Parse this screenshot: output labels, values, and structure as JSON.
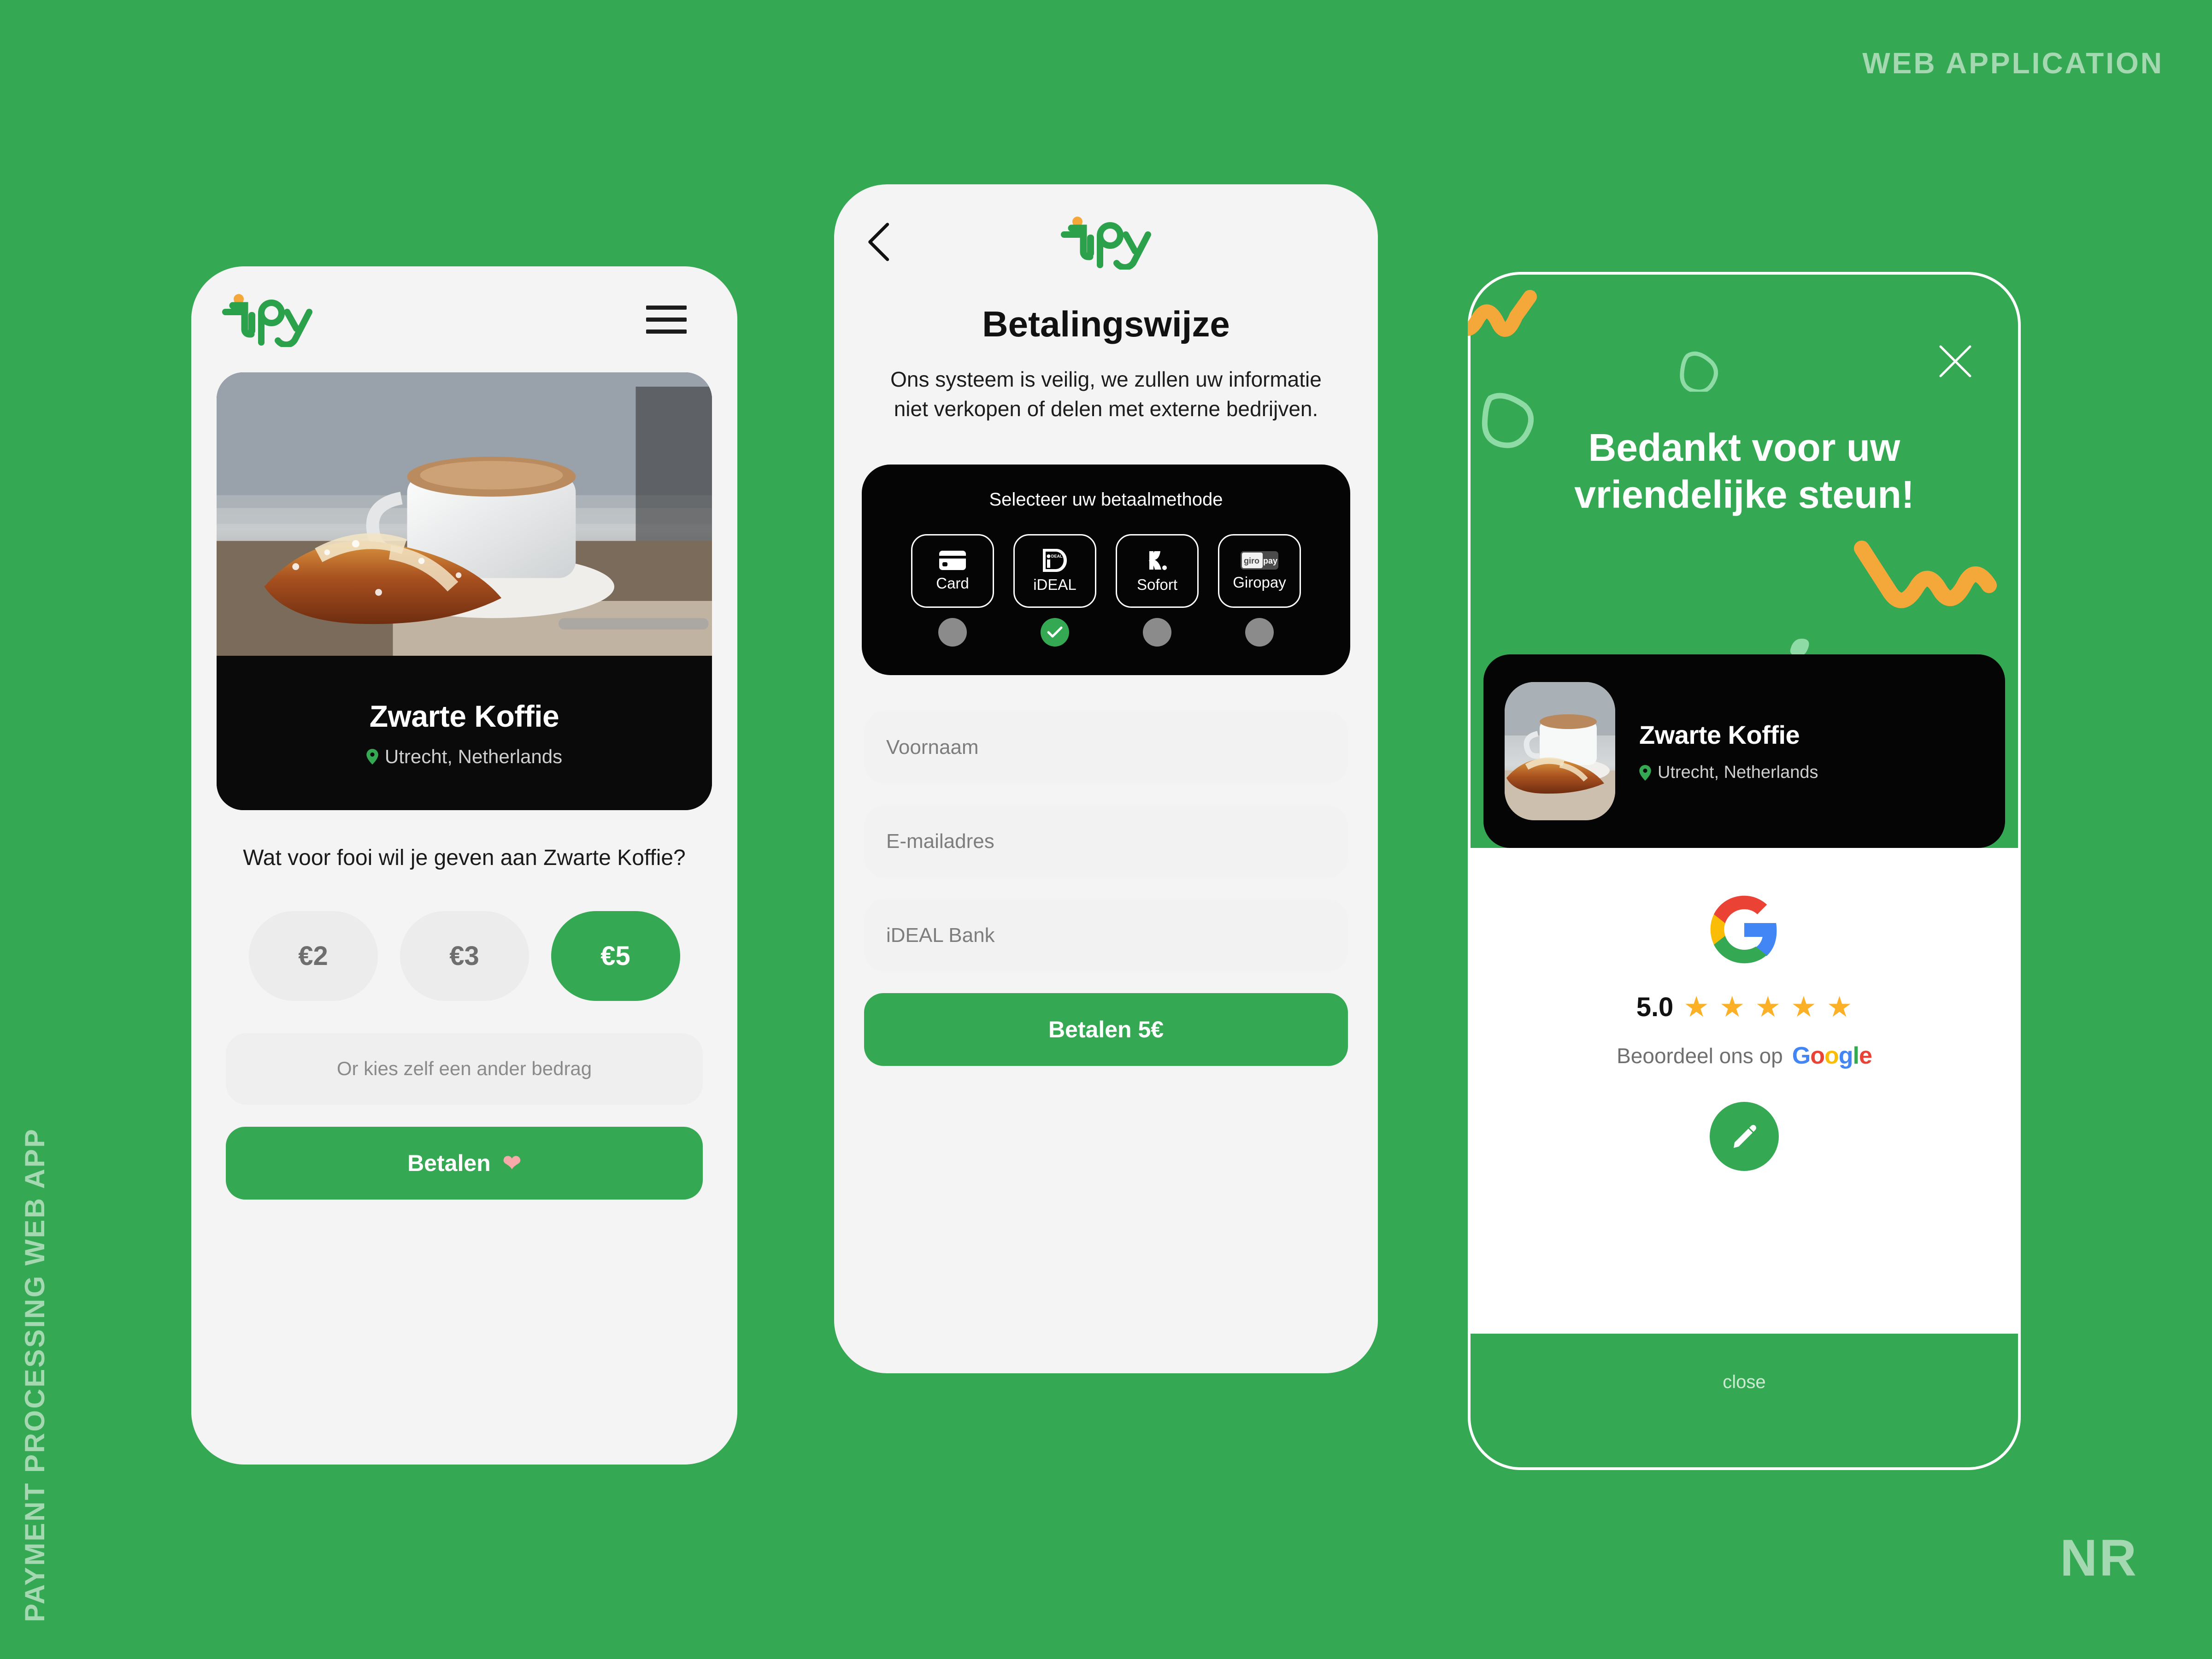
{
  "page": {
    "top_right_label": "WEB APPLICATION",
    "side_label": "PAYMENT PROCESSING WEB APP",
    "signature": "NR",
    "background_color": "#35a853",
    "accent_green": "#35a853",
    "accent_orange": "#f5a83a",
    "dark_card": "#050505"
  },
  "phone_tip": {
    "logo_name": "tipsy",
    "menu_icon": "hamburger-icon",
    "venue": {
      "name": "Zwarte Koffie",
      "location": "Utrecht, Netherlands",
      "location_icon": "map-pin-icon",
      "photo": "coffee-cup-and-croissant-photo"
    },
    "question": "Wat voor fooi wil je geven aan Zwarte Koffie?",
    "amounts": [
      {
        "label": "€2",
        "selected": false
      },
      {
        "label": "€3",
        "selected": false
      },
      {
        "label": "€5",
        "selected": true
      }
    ],
    "custom_amount_placeholder": "Or kies zelf een ander bedrag",
    "custom_amount_value": "",
    "pay_button": "Betalen",
    "pay_button_icon": "heart-icon"
  },
  "phone_payment": {
    "back_icon": "chevron-left-icon",
    "logo_name": "tipsy",
    "title": "Betalingswijze",
    "subtitle": "Ons systeem is veilig, we zullen uw informatie niet verkopen of delen met externe bedrijven.",
    "methods_title": "Selecteer uw betaalmethode",
    "methods": [
      {
        "label": "Card",
        "icon": "credit-card-icon",
        "selected": false
      },
      {
        "label": "iDEAL",
        "icon": "ideal-logo-icon",
        "selected": true
      },
      {
        "label": "Sofort",
        "icon": "klarna-sofort-logo-icon",
        "selected": false
      },
      {
        "label": "Giropay",
        "icon": "giropay-logo-icon",
        "selected": false
      }
    ],
    "fields": [
      {
        "name": "first-name",
        "placeholder": "Voornaam",
        "value": ""
      },
      {
        "name": "email",
        "placeholder": "E-mailadres",
        "value": ""
      },
      {
        "name": "ideal-bank",
        "placeholder": "iDEAL Bank",
        "value": ""
      }
    ],
    "pay_button": "Betalen 5€"
  },
  "phone_thanks": {
    "close_icon": "close-x-icon",
    "heading": "Bedankt voor uw vriendelijke steun!",
    "venue": {
      "name": "Zwarte Koffie",
      "location": "Utrecht, Netherlands",
      "location_icon": "map-pin-icon",
      "thumbnail": "coffee-cup-and-croissant-photo"
    },
    "google_icon": "google-g-logo-icon",
    "rating_score": "5.0",
    "rating_stars": 5,
    "star_color": "#fcb026",
    "review_prompt": "Beoordeel ons op",
    "google_wordmark": "Google",
    "edit_button_icon": "pencil-edit-icon",
    "close_link": "close",
    "decorations": [
      "orange-squiggle-top-left",
      "orange-squiggle-bottom-right",
      "green-triangle-outline-left",
      "green-triangle-outline-middle",
      "green-blob-bottom-left",
      "green-blob-top-right"
    ]
  }
}
